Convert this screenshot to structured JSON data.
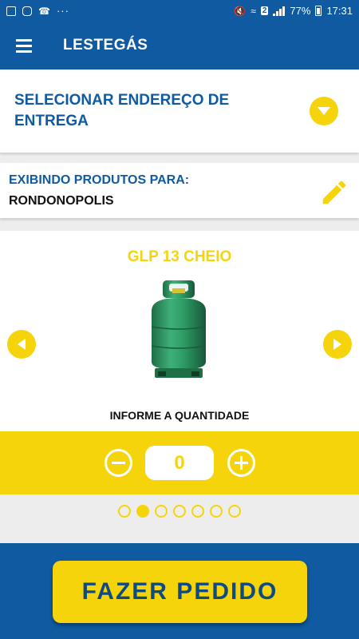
{
  "status_bar": {
    "battery": "77%",
    "time": "17:31",
    "sim_badge": "2"
  },
  "app_bar": {
    "title": "LESTEGÁS"
  },
  "address": {
    "label": "SELECIONAR ENDEREÇO DE ENTREGA"
  },
  "location": {
    "title": "EXIBINDO PRODUTOS PARA:",
    "city": "RONDONOPOLIS"
  },
  "product": {
    "name": "GLP 13 CHEIO",
    "quantity_label": "INFORME A QUANTIDADE"
  },
  "quantity": {
    "value": "0"
  },
  "pager": {
    "total": 7,
    "active_index": 1
  },
  "order_button": {
    "label": "FAZER PEDIDO"
  },
  "colors": {
    "primary_blue": "#0f5aa0",
    "accent_yellow": "#f6d40c",
    "cylinder_green": "#2e9a63"
  },
  "icons": {
    "menu": "hamburger-menu-icon",
    "dropdown": "chevron-down-icon",
    "edit": "pencil-icon",
    "prev": "chevron-left-icon",
    "next": "chevron-right-icon",
    "minus": "minus-circle-icon",
    "plus": "plus-circle-icon"
  }
}
